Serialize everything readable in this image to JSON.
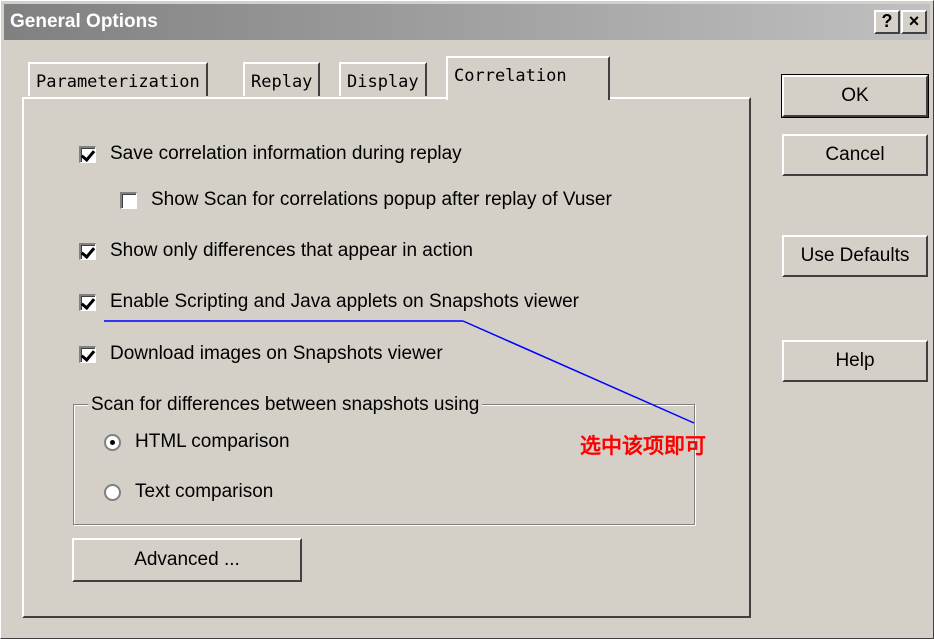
{
  "window": {
    "title": "General Options",
    "help_button": "?",
    "close_button": "×"
  },
  "tabs": [
    {
      "label": "Parameterization",
      "active": false
    },
    {
      "label": "Replay",
      "active": false
    },
    {
      "label": "Display",
      "active": false
    },
    {
      "label": "Correlation",
      "active": true
    }
  ],
  "options": {
    "save_correlation": {
      "label": "Save correlation information during replay",
      "checked": true
    },
    "show_scan_popup": {
      "label": "Show Scan for correlations popup after replay of Vuser",
      "checked": false
    },
    "show_differences": {
      "label": "Show only differences that appear in action",
      "checked": true
    },
    "enable_scripting": {
      "label": "Enable Scripting and Java applets on Snapshots viewer",
      "checked": true
    },
    "download_images": {
      "label": "Download images on Snapshots viewer",
      "checked": true
    }
  },
  "scan_group": {
    "label": "Scan for differences between snapshots using",
    "html_comparison": {
      "label": "HTML comparison",
      "selected": true
    },
    "text_comparison": {
      "label": "Text comparison",
      "selected": false
    }
  },
  "buttons": {
    "advanced": "Advanced ...",
    "ok": "OK",
    "cancel": "Cancel",
    "use_defaults": "Use Defaults",
    "help": "Help"
  },
  "annotation": {
    "text": "选中该项即可",
    "color": "#ff0000",
    "line_color": "#0000ff"
  }
}
